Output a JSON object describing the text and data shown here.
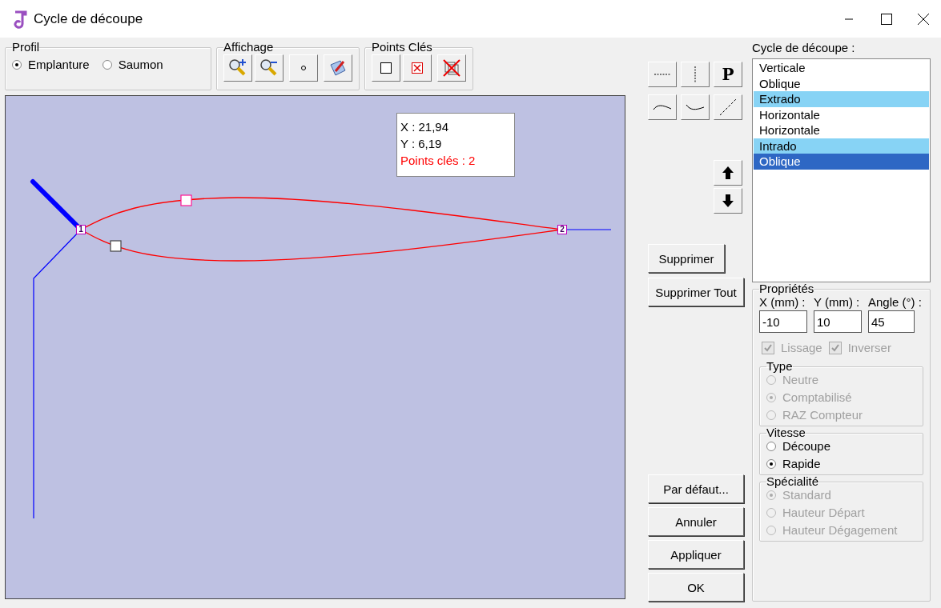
{
  "window": {
    "title": "Cycle de découpe"
  },
  "profil": {
    "label": "Profil",
    "options": [
      {
        "label": "Emplanture",
        "selected": true
      },
      {
        "label": "Saumon",
        "selected": false
      }
    ]
  },
  "affichage": {
    "label": "Affichage"
  },
  "points_cles": {
    "label": "Points Clés"
  },
  "canvas": {
    "info": {
      "x": "X : 21,94",
      "y": "Y : 6,19",
      "key_points": "Points clés : 2"
    },
    "markers": [
      {
        "label": "1"
      },
      {
        "label": "2"
      }
    ]
  },
  "tools": {
    "p_button": "P"
  },
  "cycle": {
    "label": "Cycle de découpe :",
    "items": [
      {
        "label": "Verticale",
        "selected": false,
        "highlighted": false
      },
      {
        "label": "Oblique",
        "selected": false,
        "highlighted": false
      },
      {
        "label": "Extrado",
        "selected": false,
        "highlighted": true
      },
      {
        "label": "Horizontale",
        "selected": false,
        "highlighted": false
      },
      {
        "label": "Horizontale",
        "selected": false,
        "highlighted": false
      },
      {
        "label": "Intrado",
        "selected": false,
        "highlighted": true
      },
      {
        "label": "Oblique",
        "selected": true,
        "highlighted": false
      }
    ]
  },
  "actions": [
    "Supprimer",
    "Supprimer Tout"
  ],
  "buttons": [
    "Par défaut...",
    "Annuler",
    "Appliquer",
    "OK"
  ],
  "properties": {
    "label": "Propriétés",
    "fields": [
      {
        "label": "X (mm) :",
        "value": "-10"
      },
      {
        "label": "Y (mm) :",
        "value": "10"
      },
      {
        "label": "Angle (°) :",
        "value": "45"
      }
    ],
    "checks": [
      {
        "label": "Lissage",
        "checked": true,
        "disabled": true
      },
      {
        "label": "Inverser",
        "checked": true,
        "disabled": true
      }
    ],
    "groups": [
      {
        "label": "Type",
        "disabled": true,
        "options": [
          {
            "label": "Neutre",
            "selected": false
          },
          {
            "label": "Comptabilisé",
            "selected": true
          },
          {
            "label": "RAZ Compteur",
            "selected": false
          }
        ]
      },
      {
        "label": "Vitesse",
        "disabled": false,
        "options": [
          {
            "label": "Découpe",
            "selected": false
          },
          {
            "label": "Rapide",
            "selected": true
          }
        ]
      },
      {
        "label": "Spécialité",
        "disabled": true,
        "options": [
          {
            "label": "Standard",
            "selected": true
          },
          {
            "label": "Hauteur Départ",
            "selected": false
          },
          {
            "label": "Hauteur Dégagement",
            "selected": false
          }
        ]
      }
    ]
  }
}
